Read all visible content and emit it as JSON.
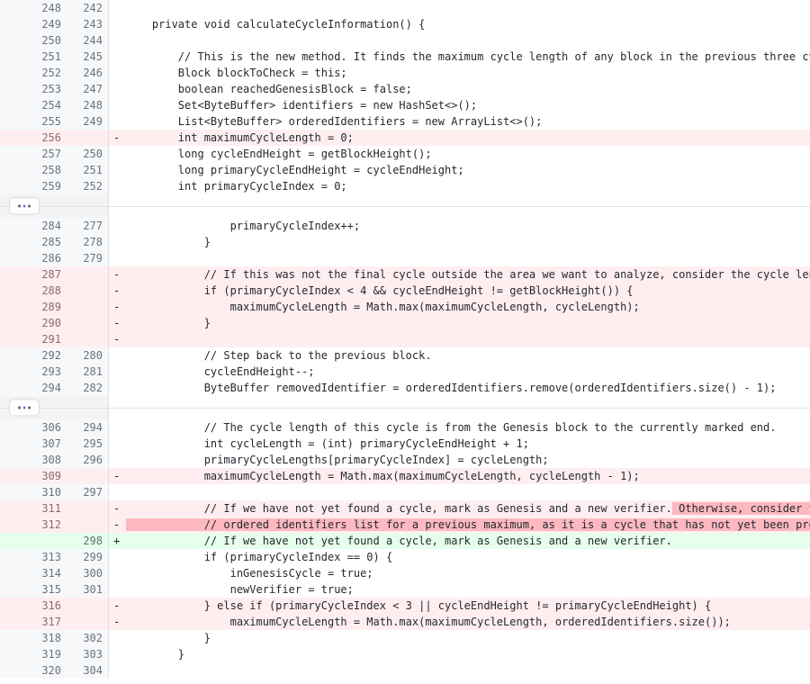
{
  "view": {
    "type": "unified-diff",
    "language": "java",
    "colors": {
      "context_bg": "#ffffff",
      "deleted_bg": "#ffeef0",
      "added_bg": "#e6ffed",
      "deleted_word_bg": "#fdb8c0",
      "added_word_bg": "#acf2bd",
      "gutter_bg": "#f6f8fa",
      "gutter_border": "#dfe2e5",
      "line_number_color": "#6a737d",
      "code_color": "#24292e",
      "expander_bg": "#f1f3f5",
      "expander_line": "#e1e4e8"
    }
  },
  "expander": {
    "label": "...",
    "name": "expand-hidden-lines-button"
  },
  "rows": [
    {
      "kind": "context",
      "old": "248",
      "new": "242",
      "marker": "",
      "code": ""
    },
    {
      "kind": "context",
      "old": "249",
      "new": "243",
      "marker": "",
      "code": "    private void calculateCycleInformation() {"
    },
    {
      "kind": "context",
      "old": "250",
      "new": "244",
      "marker": "",
      "code": ""
    },
    {
      "kind": "context",
      "old": "251",
      "new": "245",
      "marker": "",
      "code": "        // This is the new method. It finds the maximum cycle length of any block in the previous three cycles."
    },
    {
      "kind": "context",
      "old": "252",
      "new": "246",
      "marker": "",
      "code": "        Block blockToCheck = this;"
    },
    {
      "kind": "context",
      "old": "253",
      "new": "247",
      "marker": "",
      "code": "        boolean reachedGenesisBlock = false;"
    },
    {
      "kind": "context",
      "old": "254",
      "new": "248",
      "marker": "",
      "code": "        Set<ByteBuffer> identifiers = new HashSet<>();"
    },
    {
      "kind": "context",
      "old": "255",
      "new": "249",
      "marker": "",
      "code": "        List<ByteBuffer> orderedIdentifiers = new ArrayList<>();"
    },
    {
      "kind": "deleted",
      "old": "256",
      "new": "",
      "marker": "-",
      "code": "        int maximumCycleLength = 0;"
    },
    {
      "kind": "context",
      "old": "257",
      "new": "250",
      "marker": "",
      "code": "        long cycleEndHeight = getBlockHeight();"
    },
    {
      "kind": "context",
      "old": "258",
      "new": "251",
      "marker": "",
      "code": "        long primaryCycleEndHeight = cycleEndHeight;"
    },
    {
      "kind": "context",
      "old": "259",
      "new": "252",
      "marker": "",
      "code": "        int primaryCycleIndex = 0;"
    },
    {
      "kind": "expander"
    },
    {
      "kind": "context",
      "old": "284",
      "new": "277",
      "marker": "",
      "code": "                primaryCycleIndex++;"
    },
    {
      "kind": "context",
      "old": "285",
      "new": "278",
      "marker": "",
      "code": "            }"
    },
    {
      "kind": "context",
      "old": "286",
      "new": "279",
      "marker": "",
      "code": ""
    },
    {
      "kind": "deleted",
      "old": "287",
      "new": "",
      "marker": "-",
      "code": "            // If this was not the final cycle outside the area we want to analyze, consider the cycle length."
    },
    {
      "kind": "deleted",
      "old": "288",
      "new": "",
      "marker": "-",
      "code": "            if (primaryCycleIndex < 4 && cycleEndHeight != getBlockHeight()) {"
    },
    {
      "kind": "deleted",
      "old": "289",
      "new": "",
      "marker": "-",
      "code": "                maximumCycleLength = Math.max(maximumCycleLength, cycleLength);"
    },
    {
      "kind": "deleted",
      "old": "290",
      "new": "",
      "marker": "-",
      "code": "            }"
    },
    {
      "kind": "deleted",
      "old": "291",
      "new": "",
      "marker": "-",
      "code": ""
    },
    {
      "kind": "context",
      "old": "292",
      "new": "280",
      "marker": "",
      "code": "            // Step back to the previous block."
    },
    {
      "kind": "context",
      "old": "293",
      "new": "281",
      "marker": "",
      "code": "            cycleEndHeight--;"
    },
    {
      "kind": "context",
      "old": "294",
      "new": "282",
      "marker": "",
      "code": "            ByteBuffer removedIdentifier = orderedIdentifiers.remove(orderedIdentifiers.size() - 1);"
    },
    {
      "kind": "expander"
    },
    {
      "kind": "context",
      "old": "306",
      "new": "294",
      "marker": "",
      "code": "            // The cycle length of this cycle is from the Genesis block to the currently marked end."
    },
    {
      "kind": "context",
      "old": "307",
      "new": "295",
      "marker": "",
      "code": "            int cycleLength = (int) primaryCycleEndHeight + 1;"
    },
    {
      "kind": "context",
      "old": "308",
      "new": "296",
      "marker": "",
      "code": "            primaryCycleLengths[primaryCycleIndex] = cycleLength;"
    },
    {
      "kind": "deleted",
      "old": "309",
      "new": "",
      "marker": "-",
      "code": "            maximumCycleLength = Math.max(maximumCycleLength, cycleLength - 1);"
    },
    {
      "kind": "context",
      "old": "310",
      "new": "297",
      "marker": "",
      "code": ""
    },
    {
      "kind": "deleted",
      "old": "311",
      "new": "",
      "marker": "-",
      "segments": [
        {
          "text": "            // If we have not yet found a cycle, mark as Genesis and a new verifier.",
          "highlight": false
        },
        {
          "text": " Otherwise, consider the",
          "highlight": true
        }
      ]
    },
    {
      "kind": "deleted",
      "old": "312",
      "new": "",
      "marker": "-",
      "segments": [
        {
          "text": "            // ordered identifiers list for a previous maximum, as it is a cycle that has not yet been processed.",
          "highlight": true
        }
      ]
    },
    {
      "kind": "added",
      "old": "",
      "new": "298",
      "marker": "+",
      "code": "            // If we have not yet found a cycle, mark as Genesis and a new verifier."
    },
    {
      "kind": "context",
      "old": "313",
      "new": "299",
      "marker": "",
      "code": "            if (primaryCycleIndex == 0) {"
    },
    {
      "kind": "context",
      "old": "314",
      "new": "300",
      "marker": "",
      "code": "                inGenesisCycle = true;"
    },
    {
      "kind": "context",
      "old": "315",
      "new": "301",
      "marker": "",
      "code": "                newVerifier = true;"
    },
    {
      "kind": "deleted",
      "old": "316",
      "new": "",
      "marker": "-",
      "code": "            } else if (primaryCycleIndex < 3 || cycleEndHeight != primaryCycleEndHeight) {"
    },
    {
      "kind": "deleted",
      "old": "317",
      "new": "",
      "marker": "-",
      "code": "                maximumCycleLength = Math.max(maximumCycleLength, orderedIdentifiers.size());"
    },
    {
      "kind": "context",
      "old": "318",
      "new": "302",
      "marker": "",
      "code": "            }"
    },
    {
      "kind": "context",
      "old": "319",
      "new": "303",
      "marker": "",
      "code": "        }"
    },
    {
      "kind": "context",
      "old": "320",
      "new": "304",
      "marker": "",
      "code": ""
    }
  ]
}
